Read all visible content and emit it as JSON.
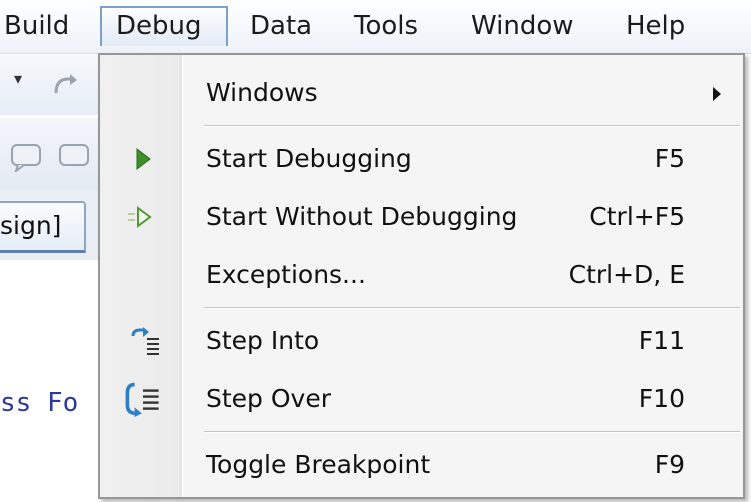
{
  "menubar": {
    "items": [
      {
        "label": "Build"
      },
      {
        "label": "Debug"
      },
      {
        "label": "Data"
      },
      {
        "label": "Tools"
      },
      {
        "label": "Window"
      },
      {
        "label": "Help"
      }
    ],
    "active": "Debug"
  },
  "background": {
    "tab_label": "sign]",
    "code_text": "ss Fo"
  },
  "debug_menu": {
    "items": [
      {
        "label": "Windows",
        "shortcut": "",
        "submenu": true,
        "icon": ""
      },
      {
        "label": "Start Debugging",
        "shortcut": "F5",
        "icon": "play-icon"
      },
      {
        "label": "Start Without Debugging",
        "shortcut": "Ctrl+F5",
        "icon": "play-outline-icon"
      },
      {
        "label": "Exceptions...",
        "shortcut": "Ctrl+D, E",
        "icon": ""
      },
      {
        "label": "Step Into",
        "shortcut": "F11",
        "icon": "step-into-icon"
      },
      {
        "label": "Step Over",
        "shortcut": "F10",
        "icon": "step-over-icon"
      },
      {
        "label": "Toggle Breakpoint",
        "shortcut": "F9",
        "icon": ""
      }
    ]
  },
  "colors": {
    "menu_border": "#979797",
    "active_border": "#7e9fc7",
    "play_green": "#3e8f2a"
  }
}
